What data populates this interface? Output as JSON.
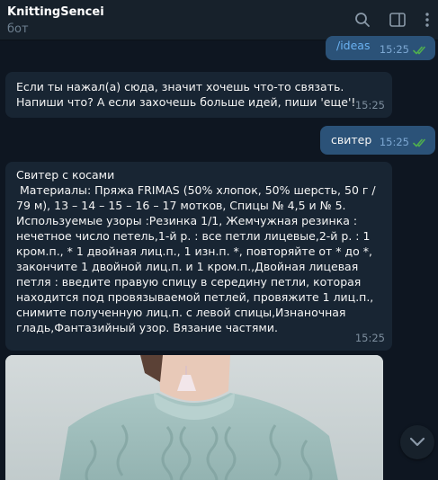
{
  "header": {
    "title": "KnittingSencei",
    "subtitle": "бот",
    "icons": [
      "search-icon",
      "sidebar-toggle-icon",
      "more-vertical-icon"
    ]
  },
  "messages": [
    {
      "direction": "out",
      "text": "/ideas",
      "time": "15:25",
      "status": "read"
    },
    {
      "direction": "in",
      "text": "Если ты нажал(а) сюда, значит хочешь что-то связать. Напиши что? А если захочешь больше идей, пиши 'еще'!",
      "time": "15:25"
    },
    {
      "direction": "out",
      "text": "свитер",
      "time": "15:25",
      "status": "read"
    },
    {
      "direction": "in",
      "text": "Свитер с косами\n Материалы: Пряжа FRIMAS (50% хлопок, 50% шерсть, 50 г / 79 м), 13 – 14 – 15 – 16 – 17 мотков, Спицы № 4,5 и № 5. Используемые узоры :Резинка 1/1, Жемчужная резинка : нечетное число петель,1-й р. : все петли лицевые,2-й р. : 1 кром.п., * 1 двойная лиц.п., 1 изн.п. *, повторяйте от * до *, закончите 1 двойной лиц.п. и 1 кром.п.,Двойная лицевая петля : введите правую спицу в середину петли, которая находится под провязываемой петлей, провяжите 1 лиц.п., снимите полученную лиц.п. с левой спицы,Изнаночная гладь,Фантазийный узор. Вязание частями.",
      "time": "15:25"
    }
  ],
  "photo": {
    "alt_icon": "photo-knitted-sweater"
  },
  "colors": {
    "background": "#0e1621",
    "header": "#17212b",
    "bubble_out": "#2b5278",
    "bubble_in": "#182533",
    "link": "#6ab2f2",
    "read_check": "#4fae4e"
  }
}
